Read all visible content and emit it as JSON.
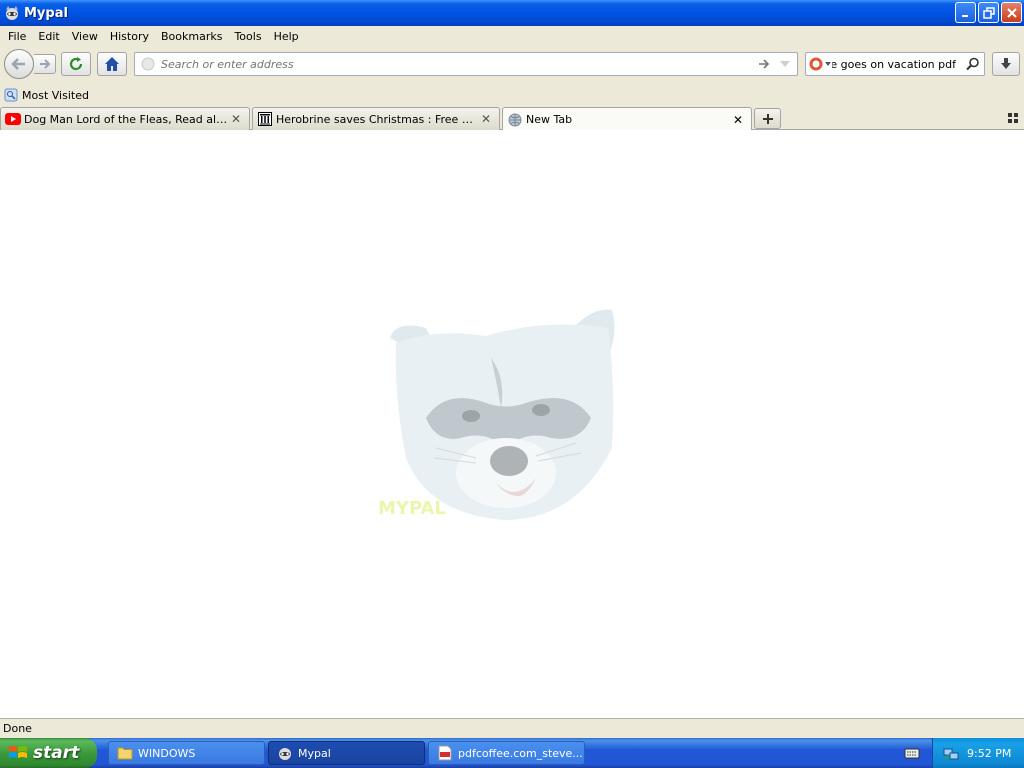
{
  "window": {
    "title": "Mypal"
  },
  "menu": {
    "items": [
      {
        "label": "File"
      },
      {
        "label": "Edit"
      },
      {
        "label": "View"
      },
      {
        "label": "History"
      },
      {
        "label": "Bookmarks"
      },
      {
        "label": "Tools"
      },
      {
        "label": "Help"
      }
    ]
  },
  "navbar": {
    "address_placeholder": "Search or enter address",
    "search_value": "ine goes on vacation pdf"
  },
  "bookmarks": {
    "items": [
      {
        "label": "Most Visited"
      }
    ]
  },
  "tabs": [
    {
      "label": "Dog Man Lord of the Fleas, Read aloud, ...",
      "icon": "youtube-icon",
      "active": false
    },
    {
      "label": "Herobrine saves Christmas : Free Downlo...",
      "icon": "archive-icon",
      "active": false
    },
    {
      "label": "New Tab",
      "icon": "globe-icon",
      "active": true
    }
  ],
  "content": {
    "logo_text": "MYPAL"
  },
  "status": {
    "text": "Done"
  },
  "taskbar": {
    "start_label": "start",
    "tasks": [
      {
        "label": "WINDOWS",
        "icon": "folder-icon",
        "active": false
      },
      {
        "label": "Mypal",
        "icon": "mypal-icon",
        "active": true
      },
      {
        "label": "pdfcoffee.com_steve...",
        "icon": "pdf-icon",
        "active": false
      }
    ],
    "clock": "9:52 PM"
  },
  "colors": {
    "titlebar": "#0054e3",
    "chrome": "#ece9d8",
    "taskbar": "#2157d7",
    "start": "#3c9a3c",
    "tray": "#0f8ad6"
  }
}
